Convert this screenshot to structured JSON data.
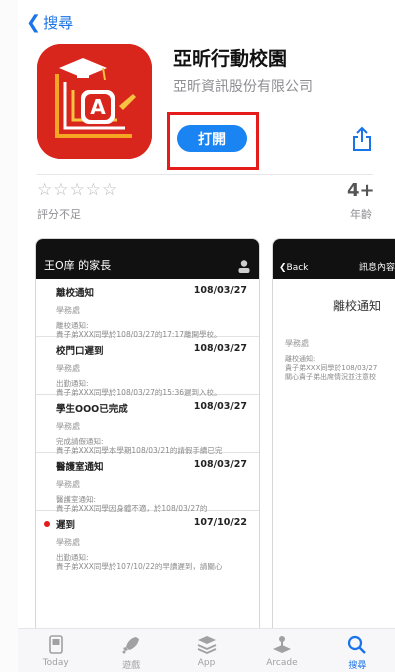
{
  "nav": {
    "back_label": "搜尋"
  },
  "app": {
    "title": "亞昕行動校園",
    "vendor": "亞昕資訊股份有限公司",
    "open_label": "打開",
    "stars": "☆☆☆☆☆",
    "rating_label": "評分不足",
    "age_value": "4+",
    "age_label": "年齡"
  },
  "shot1": {
    "header": "王O庠  的家長",
    "messages": [
      {
        "title": "離校通知",
        "date": "108/03/27",
        "dept": "學務處",
        "body1": "離校通知:",
        "body2": "貴子弟XXX同學於108/03/27的17:17離開學校。"
      },
      {
        "title": "校門口遲到",
        "date": "108/03/27",
        "dept": "學務處",
        "body1": "出勤通知:",
        "body2": "貴子弟XXX同學於108/03/27的15:36遲到入校。"
      },
      {
        "title": "學生OOO已完成",
        "date": "108/03/27",
        "dept": "學務處",
        "body1": "完成請假通知:",
        "body2": "貴子弟XXX同學本學期108/03/21的請假手續已完"
      },
      {
        "title": "醫護室通知",
        "date": "108/03/27",
        "dept": "學務處",
        "body1": "醫護室通知:",
        "body2": "貴子弟XXX同學因身體不適，於108/03/27的"
      },
      {
        "title": "遲到",
        "date": "107/10/22",
        "dept": "學務處",
        "body1": "出勤通知:",
        "body2": "貴子弟XXX同學於107/10/22的早讀遲到，請關心"
      }
    ]
  },
  "shot2": {
    "back": "Back",
    "header": "訊息內容",
    "title": "離校通知",
    "dept": "學務處",
    "body1": "離校通知:",
    "body2": "貴子弟XXX同學於108/03/27",
    "body3": "關心貴子弟出席情況並注意校"
  },
  "tabs": [
    {
      "label": "Today",
      "icon": "today-icon"
    },
    {
      "label": "遊戲",
      "icon": "rocket-icon"
    },
    {
      "label": "App",
      "icon": "app-stack-icon"
    },
    {
      "label": "Arcade",
      "icon": "arcade-joystick-icon"
    },
    {
      "label": "搜尋",
      "icon": "search-icon",
      "active": true
    }
  ],
  "colors": {
    "accent": "#1a73e8",
    "highlight": "#e61b1b",
    "app_red": "#d9261c"
  }
}
